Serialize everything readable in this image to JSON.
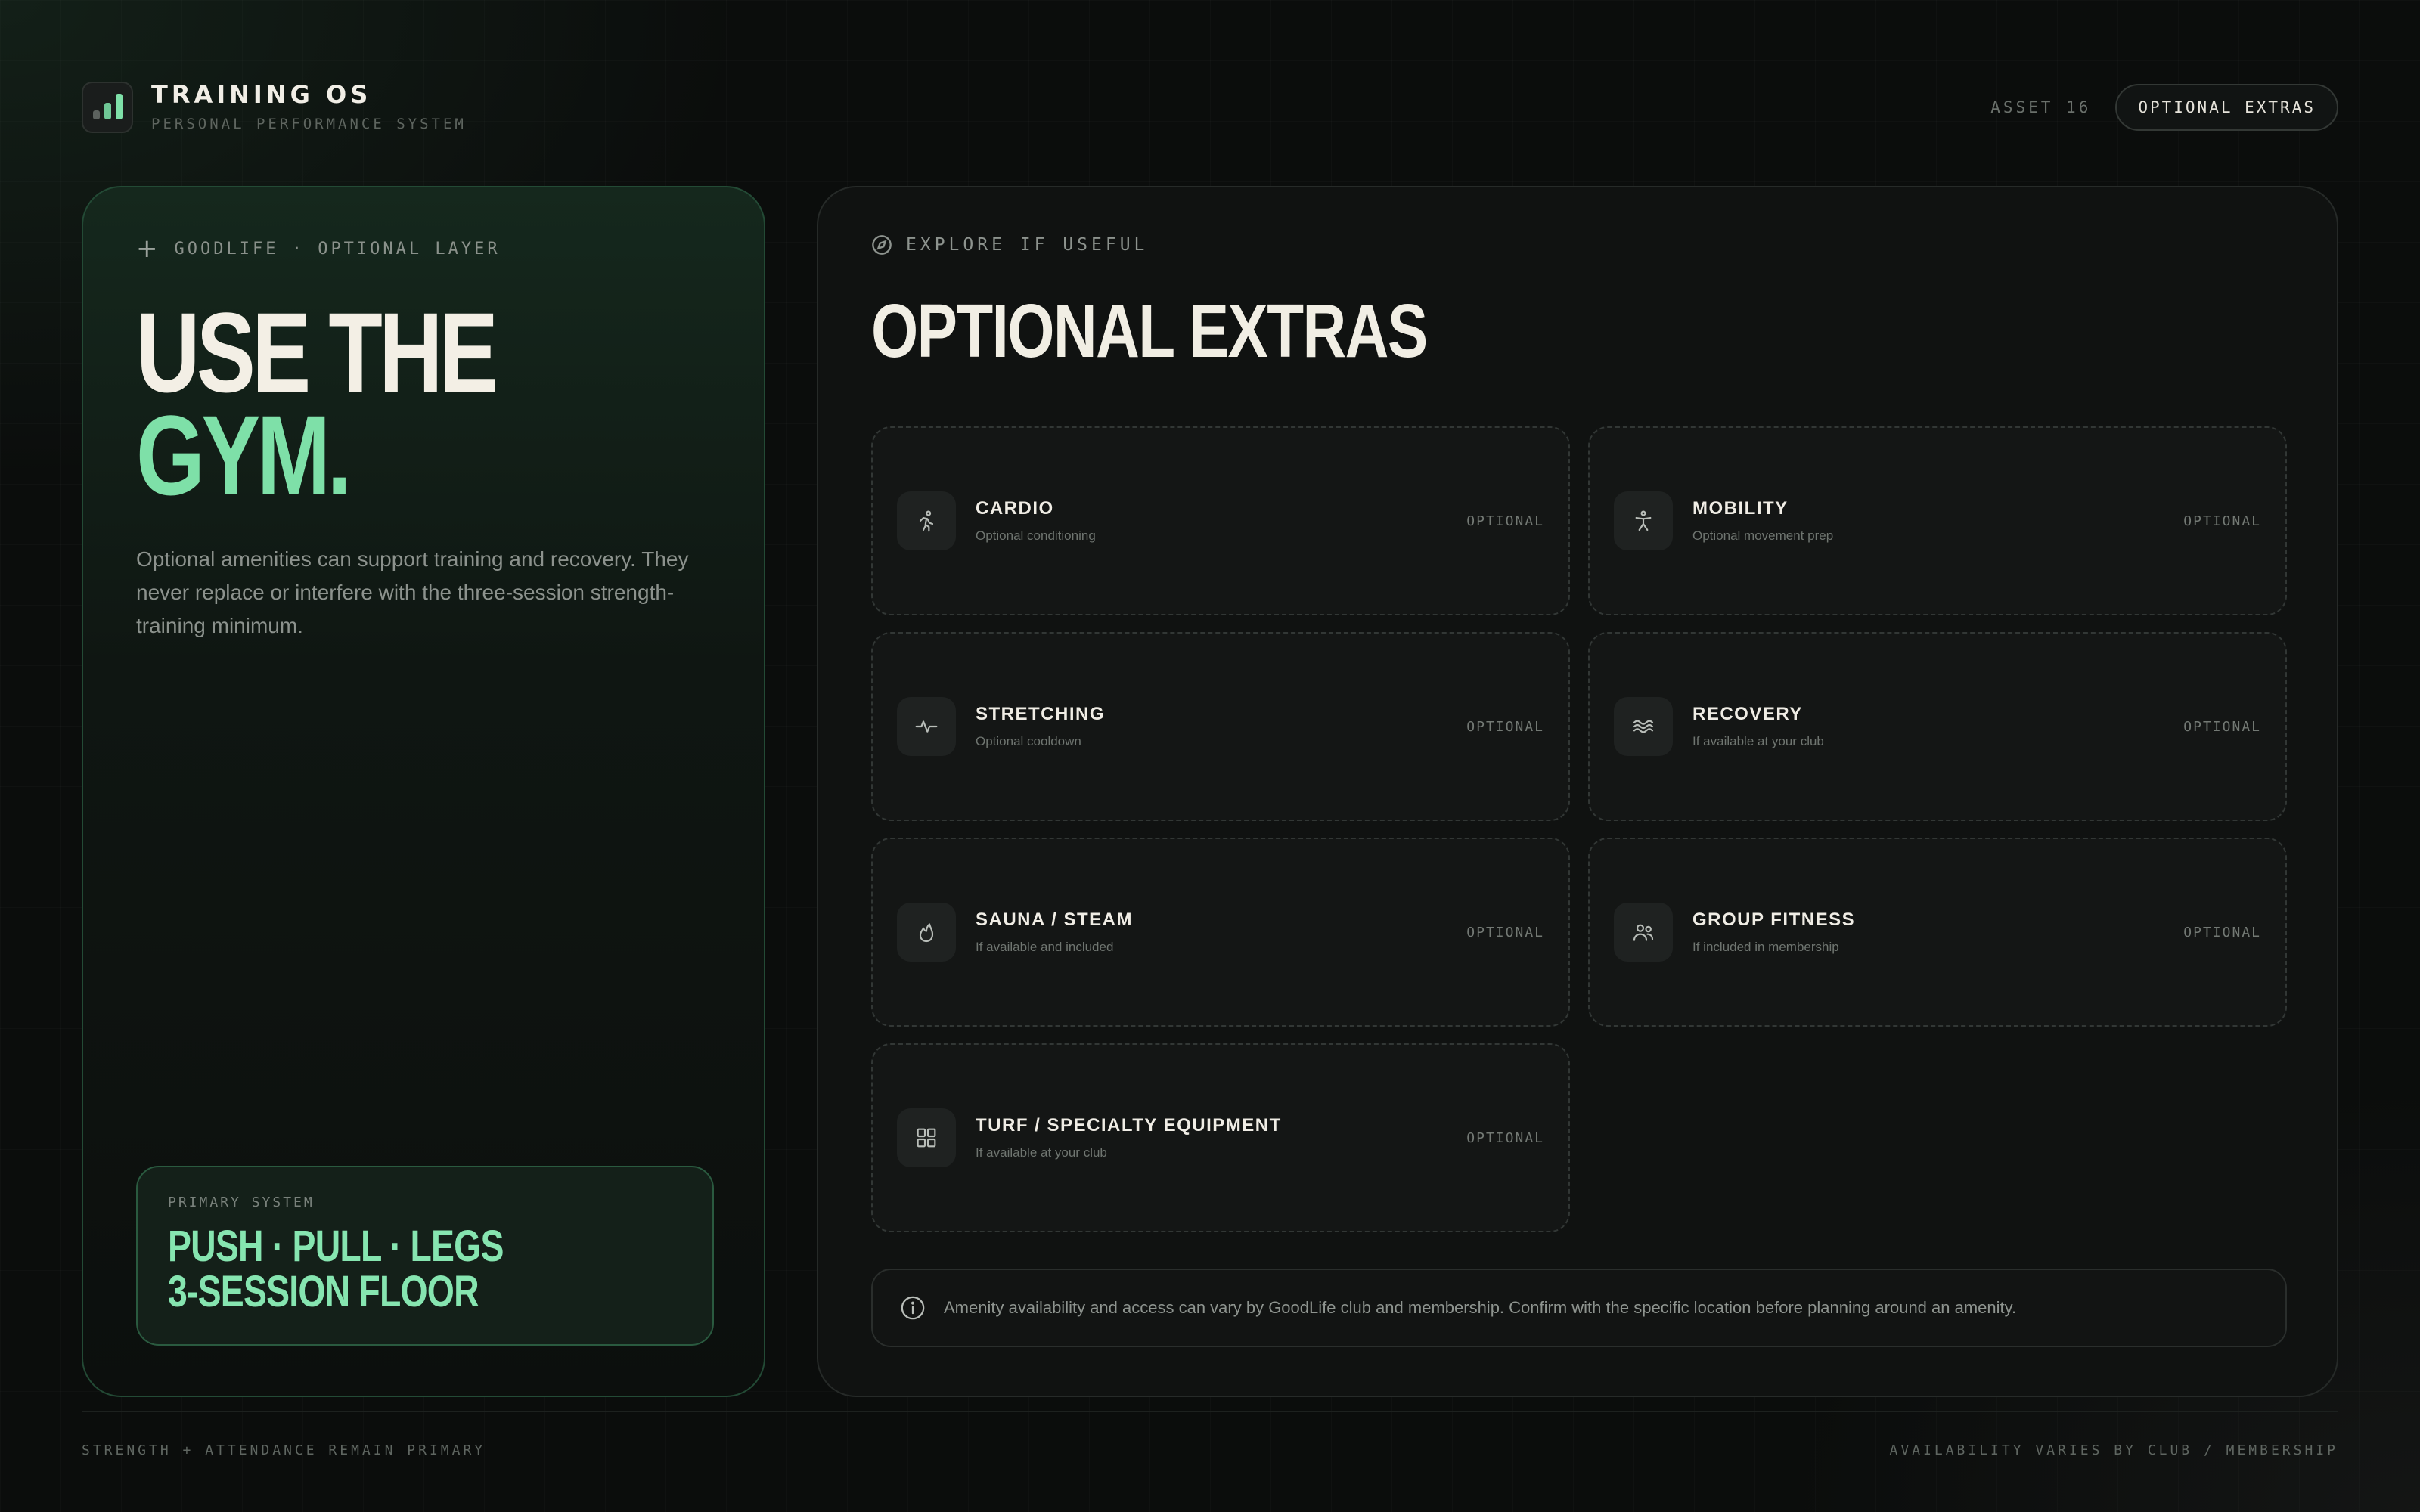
{
  "header": {
    "brand_title": "TRAINING OS",
    "brand_subtitle": "PERSONAL PERFORMANCE SYSTEM",
    "asset_label": "ASSET 16",
    "pill_label": "OPTIONAL EXTRAS",
    "logo_icon": "bar-chart-icon"
  },
  "left_card": {
    "eyebrow": "GOODLIFE · OPTIONAL LAYER",
    "hero_line1": "USE THE",
    "hero_line2": "GYM.",
    "description": "Optional amenities can support training and recovery. They never replace or interfere with the three-session strength-training minimum.",
    "primary": {
      "label": "PRIMARY SYSTEM",
      "line1": "PUSH · PULL · LEGS",
      "line2": "3-SESSION FLOOR"
    }
  },
  "right_card": {
    "eyebrow": "EXPLORE IF USEFUL",
    "title": "OPTIONAL EXTRAS",
    "tiles": [
      {
        "title": "CARDIO",
        "subtitle": "Optional conditioning",
        "badge": "OPTIONAL",
        "icon": "running-icon"
      },
      {
        "title": "MOBILITY",
        "subtitle": "Optional movement prep",
        "badge": "OPTIONAL",
        "icon": "person-stretch-icon"
      },
      {
        "title": "STRETCHING",
        "subtitle": "Optional cooldown",
        "badge": "OPTIONAL",
        "icon": "pulse-icon"
      },
      {
        "title": "RECOVERY",
        "subtitle": "If available at your club",
        "badge": "OPTIONAL",
        "icon": "waves-icon"
      },
      {
        "title": "SAUNA / STEAM",
        "subtitle": "If available and included",
        "badge": "OPTIONAL",
        "icon": "flame-icon"
      },
      {
        "title": "GROUP FITNESS",
        "subtitle": "If included in membership",
        "badge": "OPTIONAL",
        "icon": "users-icon"
      },
      {
        "title": "TURF / SPECIALTY EQUIPMENT",
        "subtitle": "If available at your club",
        "badge": "OPTIONAL",
        "icon": "grid-icon"
      }
    ],
    "notice": "Amenity availability and access can vary by GoodLife club and membership. Confirm with the specific location before planning around an amenity."
  },
  "footer": {
    "left": "STRENGTH + ATTENDANCE REMAIN PRIMARY",
    "right": "AVAILABILITY VARIES BY CLUB / MEMBERSHIP"
  },
  "colors": {
    "accent_green": "#7ee0a8",
    "background": "#0b0d0c",
    "text_primary": "#f1eee4"
  }
}
